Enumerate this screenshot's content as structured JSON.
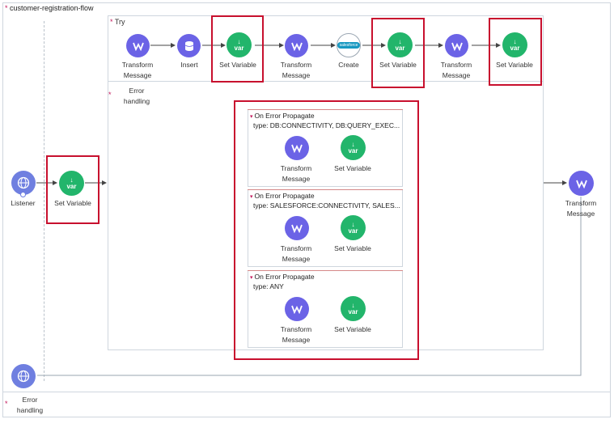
{
  "flow": {
    "name": "customer-registration-flow"
  },
  "source": {
    "listener_label": "Listener",
    "set_variable_label": "Set Variable"
  },
  "try": {
    "label": "Try",
    "steps": [
      {
        "label": "Transform\nMessage",
        "icon": "transform-icon"
      },
      {
        "label": "Insert",
        "icon": "database-icon"
      },
      {
        "label": "Set Variable",
        "icon": "var-icon"
      },
      {
        "label": "Transform\nMessage",
        "icon": "transform-icon"
      },
      {
        "label": "Create",
        "icon": "salesforce-icon"
      },
      {
        "label": "Set Variable",
        "icon": "var-icon"
      },
      {
        "label": "Transform\nMessage",
        "icon": "transform-icon"
      },
      {
        "label": "Set Variable",
        "icon": "var-icon"
      }
    ]
  },
  "try_error_handling": {
    "label": "Error\nhandling"
  },
  "error_handlers": [
    {
      "title": "On Error Propagate",
      "type": "type: DB:CONNECTIVITY, DB:QUERY_EXEC...",
      "transform_label": "Transform\nMessage",
      "setvar_label": "Set Variable"
    },
    {
      "title": "On Error Propagate",
      "type": "type: SALESFORCE:CONNECTIVITY, SALES...",
      "transform_label": "Transform\nMessage",
      "setvar_label": "Set Variable"
    },
    {
      "title": "On Error Propagate",
      "type": "type: ANY",
      "transform_label": "Transform\nMessage",
      "setvar_label": "Set Variable"
    }
  ],
  "after_try": {
    "label": "Transform\nMessage"
  },
  "flow_error_handling": {
    "label": "Error\nhandling"
  },
  "var_glyph": {
    "arrow": "↓",
    "text": "var"
  },
  "salesforce_glyph": "salesforce",
  "colors": {
    "transform": "#6b63e6",
    "setvar": "#22b56b",
    "highlight": "#c8102e",
    "listener": "#6f7fe0"
  }
}
